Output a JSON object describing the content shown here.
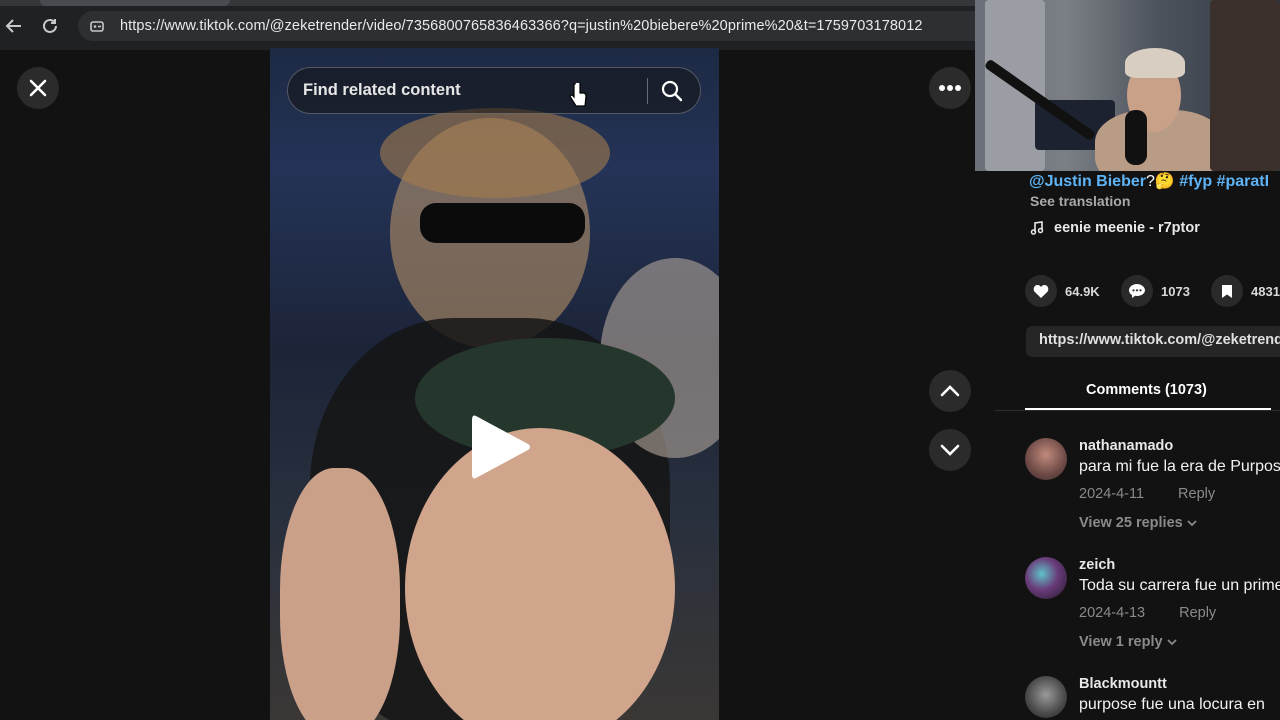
{
  "browser": {
    "url": "https://www.tiktok.com/@zeketrender/video/7356800765836463366?q=justin%20biebere%20prime%20&t=1759703178012"
  },
  "player": {
    "search_placeholder": "Find related content"
  },
  "post": {
    "mention": "@Justin Bieber",
    "question_mark": "?",
    "hashtags": "#fyp #paratI",
    "see_translation": "See translation",
    "sound": "eenie meenie - r7ptor",
    "likes": "64.9K",
    "comments_count": "1073",
    "saves": "4831",
    "share_link": "https://www.tiktok.com/@zeketrender"
  },
  "comments_tab": {
    "label": "Comments (1073)"
  },
  "comments": [
    {
      "user": "nathanamado",
      "text": "para mi fue la era de Purpose",
      "date": "2024-4-11",
      "reply_label": "Reply",
      "view_replies": "View 25 replies"
    },
    {
      "user": "zeich",
      "text": "Toda su carrera fue un prime",
      "date": "2024-4-13",
      "reply_label": "Reply",
      "view_replies": "View 1 reply"
    },
    {
      "user": "Blackmountt",
      "text": "purpose fue una locura en"
    }
  ],
  "colors": {
    "hashtag": "#5eb4f6",
    "background": "#121212",
    "muted_text": "#8a8a8a"
  }
}
